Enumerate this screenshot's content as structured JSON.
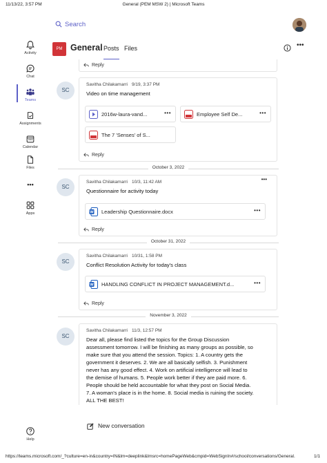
{
  "print": {
    "datetime": "11/13/22, 3:57 PM",
    "title": "General (PEM MSW 2) | Microsoft Teams",
    "url": "https://teams.microsoft.com/_?culture=en-in&country=IN&lm=deeplink&lmsrc=homePageWeb&cmpid=WebSignIn#/school/conversations/General...",
    "page": "1/1"
  },
  "rail": {
    "activity": "Activity",
    "chat": "Chat",
    "teams": "Teams",
    "assignments": "Assignments",
    "calendar": "Calendar",
    "files": "Files",
    "more": "•••",
    "apps": "Apps",
    "help": "Help"
  },
  "search": {
    "label": "Search"
  },
  "channel": {
    "badge": "PM",
    "name": "General",
    "tabs": {
      "posts": "Posts",
      "files": "Files"
    },
    "more": "•••"
  },
  "reply_label": "Reply",
  "posts": [
    {
      "avatar": "SC",
      "author": "Savitha Chilakamarri",
      "time": "9/19, 3:37 PM",
      "body": "Video on time management",
      "attachments": [
        {
          "name": "2016w-laura-vand...",
          "type": "video"
        },
        {
          "name": "Employee Self De...",
          "type": "pdf"
        },
        {
          "name": "The 7 'Senses' of S...",
          "type": "pdf"
        }
      ]
    },
    {
      "date_divider": "October 3, 2022",
      "avatar": "SC",
      "author": "Savitha Chilakamarri",
      "time": "10/3, 11:42 AM",
      "body": "Questionnaire for activity today",
      "attachments": [
        {
          "name": "Leadership Questionnaire.docx",
          "type": "word"
        }
      ]
    },
    {
      "date_divider": "October 31, 2022",
      "avatar": "SC",
      "author": "Savitha Chilakamarri",
      "time": "10/31, 1:58 PM",
      "body": "Conflict Resolution Activity for today's class",
      "attachments": [
        {
          "name": "HANDLING CONFLICT IN PROJECT MANAGEMENT.d...",
          "type": "word"
        }
      ]
    },
    {
      "date_divider": "November 3, 2022",
      "avatar": "SC",
      "author": "Savitha Chilakamarri",
      "time": "11/3, 12:57 PM",
      "body_lines": [
        "Dear all, please find listed the topics for the Group Discussion",
        "assessment tomorrow. I will be finishing as many groups as possible, so",
        "make sure that you attend the session. Topics: 1. A country gets the",
        "government it deserves. 2. We are all basically selfish. 3. Punishment",
        "never has any good effect. 4. Work on artificial intelligence will lead to",
        "the demise of humans. 5. People work better if they are paid more. 6.",
        "People should be held accountable for what they post on Social Media.",
        "7. A woman's place is in the home. 8. Social media is ruining the society.",
        "ALL THE BEST!"
      ]
    }
  ],
  "new_conversation": "New conversation",
  "colors": {
    "accent": "#5b5fc7",
    "team_badge": "#d13438",
    "word": "#185abd",
    "pdf": "#d13438"
  }
}
